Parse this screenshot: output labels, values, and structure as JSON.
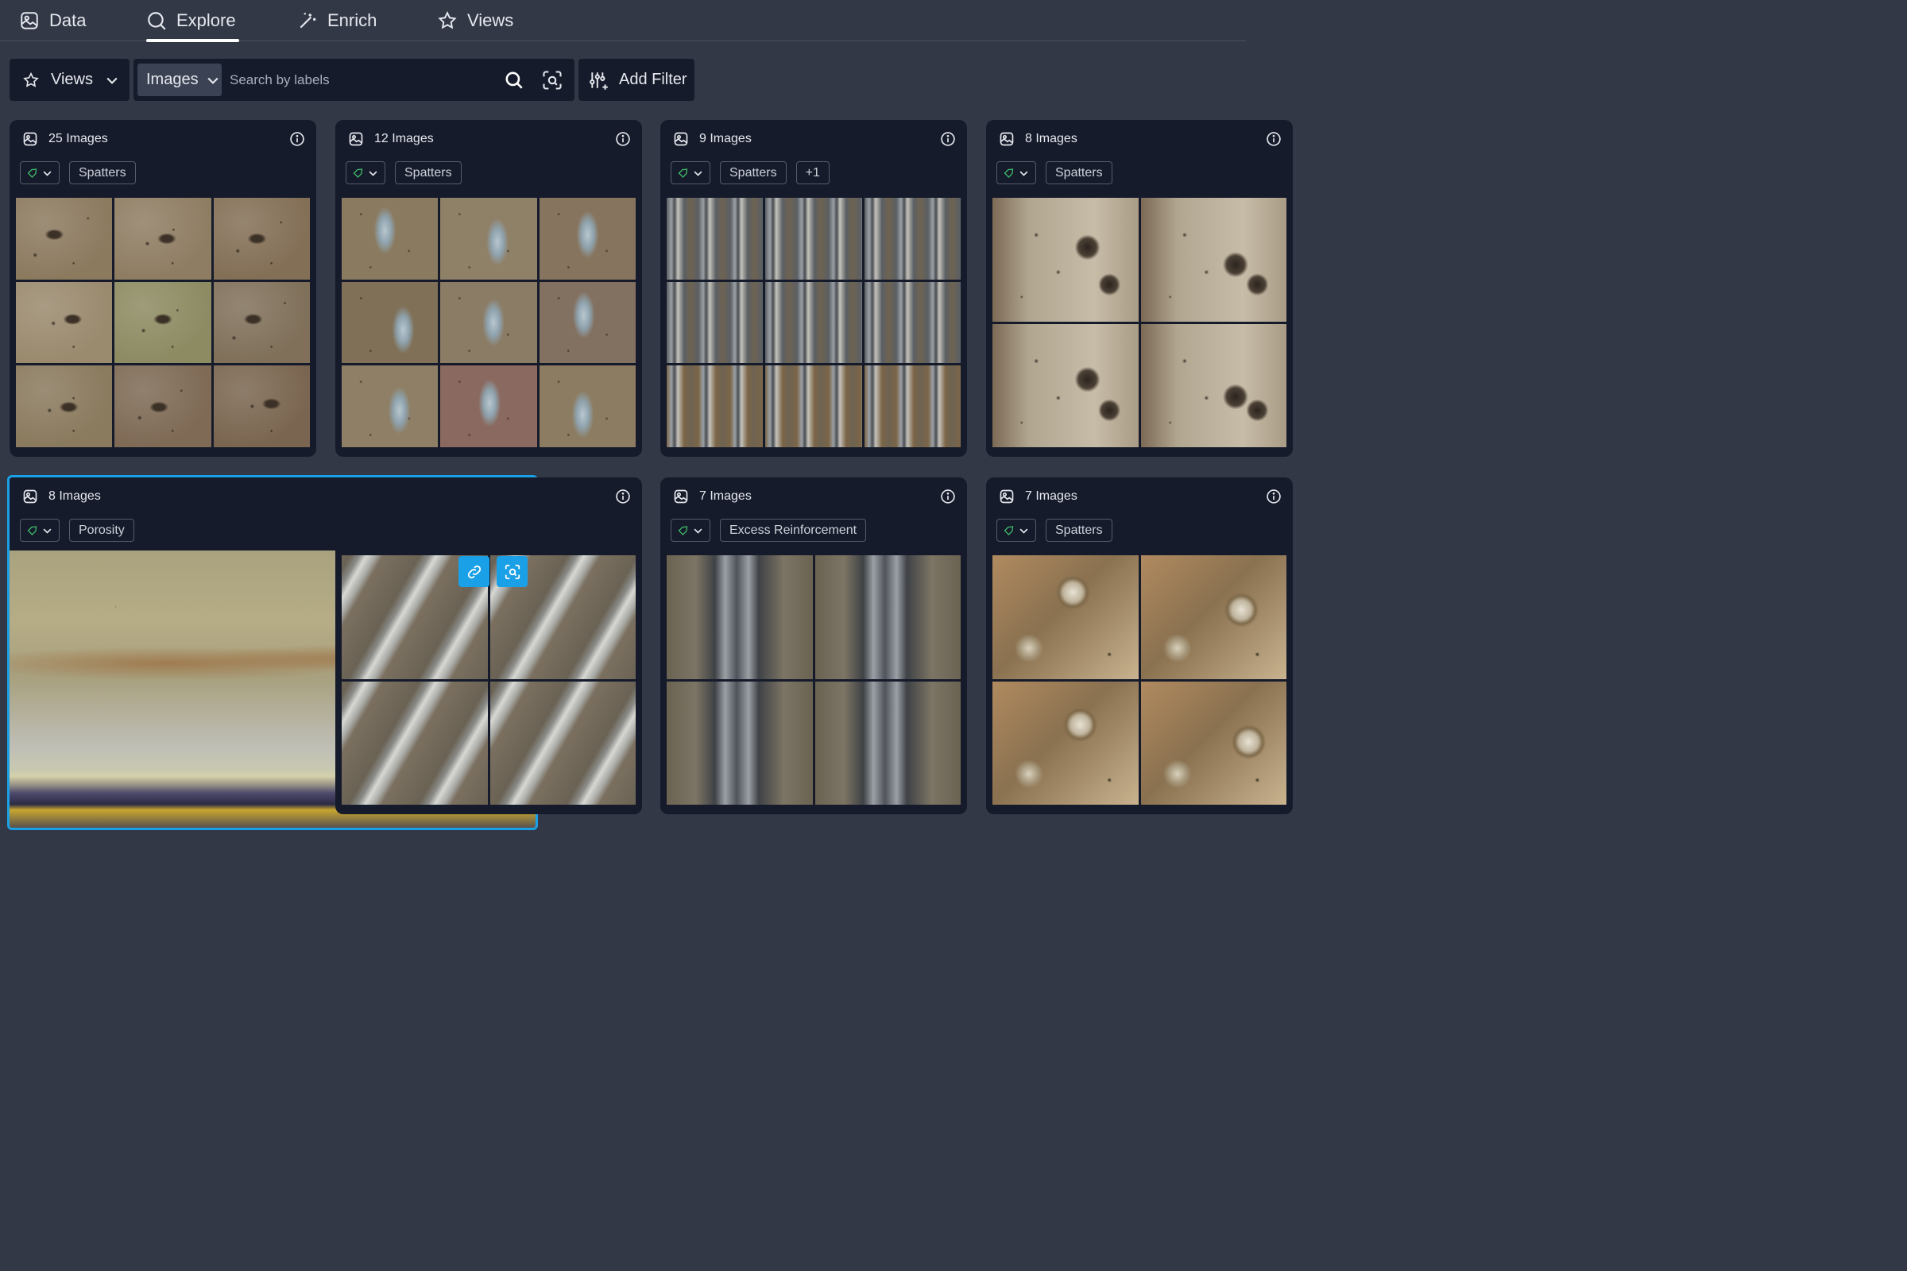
{
  "nav": {
    "tabs": [
      {
        "label": "Data",
        "icon": "image-icon"
      },
      {
        "label": "Explore",
        "icon": "search-icon"
      },
      {
        "label": "Enrich",
        "icon": "magic-wand-icon"
      },
      {
        "label": "Views",
        "icon": "star-icon"
      }
    ],
    "active_tab": "Explore"
  },
  "toolbar": {
    "views_label": "Views",
    "type_label": "Images",
    "search_placeholder": "Search by labels",
    "add_filter_label": "Add Filter"
  },
  "cards": [
    {
      "count": "25 Images",
      "tags": [
        "Spatters"
      ],
      "texture": "spatter-plate"
    },
    {
      "count": "12 Images",
      "tags": [
        "Spatters"
      ],
      "texture": "spatter-bead"
    },
    {
      "count": "9 Images",
      "tags": [
        "Spatters",
        "+1"
      ],
      "texture": "vertical-weld"
    },
    {
      "count": "8 Images",
      "tags": [
        "Spatters"
      ],
      "texture": "spatter-large"
    },
    {
      "count": "8 Images",
      "tags": [
        "Porosity"
      ],
      "texture": "porosity",
      "selected": true
    },
    {
      "count": "",
      "tags": [],
      "texture": "diagonal-weld"
    },
    {
      "count": "7 Images",
      "tags": [
        "Excess Reinforcement"
      ],
      "texture": "excess-reinforcement"
    },
    {
      "count": "7 Images",
      "tags": [
        "Spatters"
      ],
      "texture": "spatter-rings"
    }
  ],
  "colors": {
    "background": "#323846",
    "card": "#161b2b",
    "accent": "#1aa0e6",
    "status_green": "#3fbf6a"
  }
}
